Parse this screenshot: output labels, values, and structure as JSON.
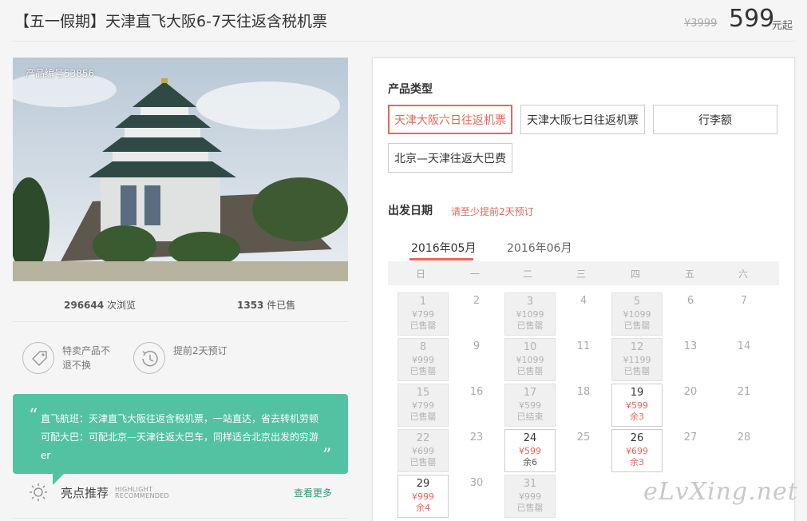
{
  "header": {
    "title": "【五一假期】天津直飞大阪6-7天往返含税机票",
    "old_price": "¥3999",
    "price": "599",
    "price_unit": "元起"
  },
  "product": {
    "number_label": "产品编号53856",
    "views_count": "296644",
    "views_label": "次浏览",
    "sold_count": "1353",
    "sold_label": "件已售"
  },
  "features": [
    {
      "icon": "tag-icon",
      "text": "特卖产品不退不换"
    },
    {
      "icon": "clock-history-icon",
      "text": "提前2天预订"
    }
  ],
  "notice": {
    "open_quote": "“",
    "close_quote": "”",
    "text": "直飞航班：天津直飞大阪往返含税机票，一站直达，省去转机劳顿 可配大巴：可配北京—天津往返大巴车，同样适合北京出发的穷游er"
  },
  "highlights": {
    "title": "亮点推荐",
    "subtitle_en_1": "HIGHLIGHT",
    "subtitle_en_2": "RECOMMENDED",
    "more": "查看更多"
  },
  "booking": {
    "type_label": "产品类型",
    "types": [
      "天津大阪六日往返机票",
      "天津大阪七日往返机票",
      "行李额",
      "北京—天津往返大巴费"
    ],
    "selected_type_index": 0,
    "date_label": "出发日期",
    "date_hint": "请至少提前2天预订",
    "months": [
      "2016年05月",
      "2016年06月"
    ],
    "active_month_index": 0,
    "weekdays": [
      "日",
      "一",
      "二",
      "三",
      "四",
      "五",
      "六"
    ],
    "days": [
      {
        "day": "1",
        "price": "¥799",
        "status": "已售罄",
        "state": "off"
      },
      {
        "day": "2",
        "state": "plain"
      },
      {
        "day": "3",
        "price": "¥1099",
        "status": "已售罄",
        "state": "off"
      },
      {
        "day": "4",
        "state": "plain"
      },
      {
        "day": "5",
        "price": "¥1099",
        "status": "已售罄",
        "state": "off"
      },
      {
        "day": "6",
        "state": "plain"
      },
      {
        "day": "7",
        "state": "plain"
      },
      {
        "day": "8",
        "price": "¥999",
        "status": "已售罄",
        "state": "off"
      },
      {
        "day": "9",
        "state": "plain"
      },
      {
        "day": "10",
        "price": "¥1099",
        "status": "已售罄",
        "state": "off"
      },
      {
        "day": "11",
        "state": "plain"
      },
      {
        "day": "12",
        "price": "¥1199",
        "status": "已售罄",
        "state": "off"
      },
      {
        "day": "13",
        "state": "plain"
      },
      {
        "day": "14",
        "state": "plain"
      },
      {
        "day": "15",
        "price": "¥799",
        "status": "已售罄",
        "state": "off"
      },
      {
        "day": "16",
        "state": "plain"
      },
      {
        "day": "17",
        "price": "¥599",
        "status": "已结束",
        "state": "off"
      },
      {
        "day": "18",
        "state": "plain"
      },
      {
        "day": "19",
        "price": "¥599",
        "status": "余3",
        "state": "on"
      },
      {
        "day": "20",
        "state": "plain"
      },
      {
        "day": "21",
        "state": "plain"
      },
      {
        "day": "22",
        "price": "¥699",
        "status": "已售罄",
        "state": "off"
      },
      {
        "day": "23",
        "state": "plain"
      },
      {
        "day": "24",
        "price": "¥599",
        "status": "余6",
        "state": "on",
        "neutral": true
      },
      {
        "day": "25",
        "state": "plain"
      },
      {
        "day": "26",
        "price": "¥699",
        "status": "余3",
        "state": "on"
      },
      {
        "day": "27",
        "state": "plain"
      },
      {
        "day": "28",
        "state": "plain"
      },
      {
        "day": "29",
        "price": "¥999",
        "status": "余4",
        "state": "on"
      },
      {
        "day": "30",
        "state": "plain"
      },
      {
        "day": "31",
        "price": "¥999",
        "status": "已售罄",
        "state": "off"
      }
    ]
  },
  "watermark": "eLvXing.net",
  "colors": {
    "accent": "#e4685a",
    "notice_bg": "#52c2a3",
    "link_green": "#2b9b7c"
  }
}
